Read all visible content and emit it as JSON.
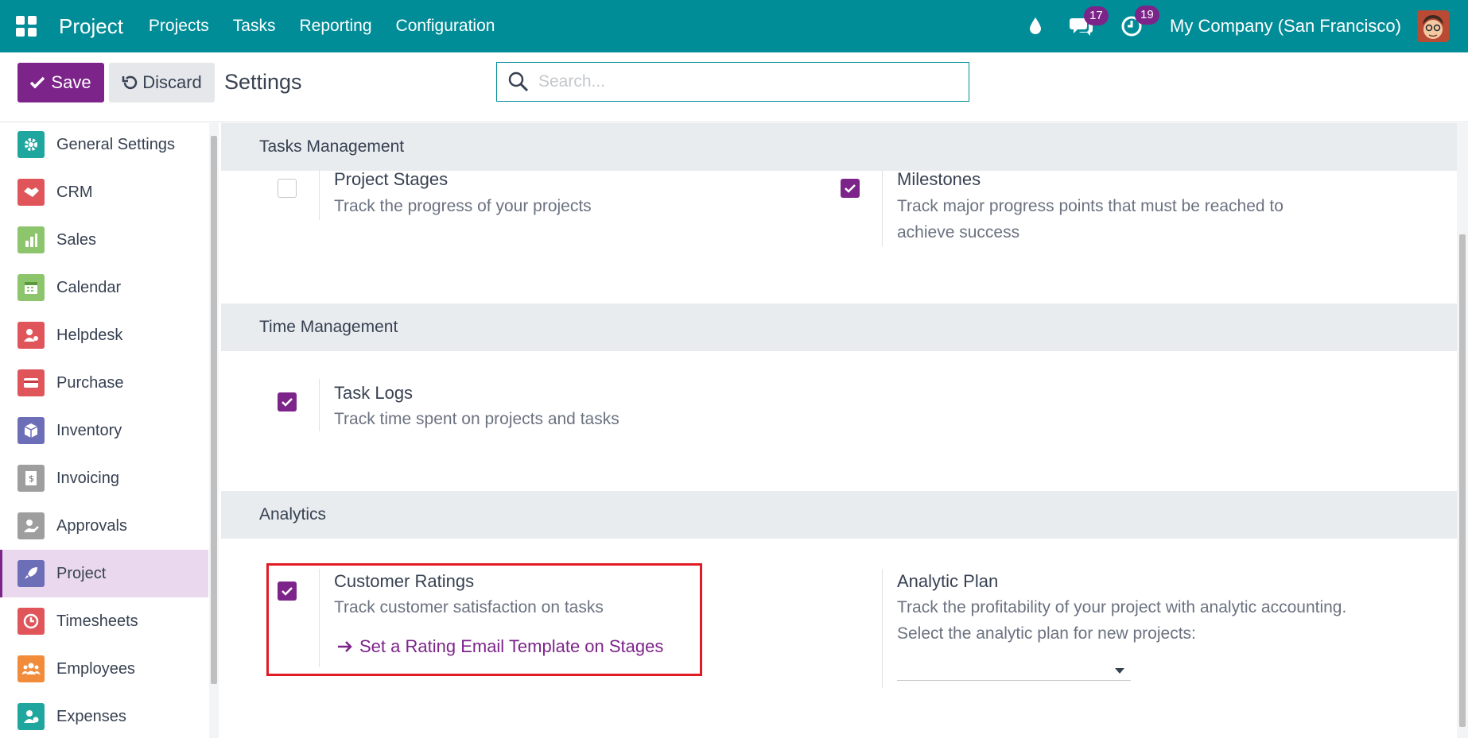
{
  "navbar": {
    "brand": "Project",
    "menu": [
      "Projects",
      "Tasks",
      "Reporting",
      "Configuration"
    ],
    "chat_badge": "17",
    "activity_badge": "19",
    "company": "My Company (San Francisco)"
  },
  "control_panel": {
    "save_label": "Save",
    "discard_label": "Discard",
    "title": "Settings",
    "search_placeholder": "Search..."
  },
  "sidebar": {
    "items": [
      {
        "label": "General Settings",
        "icon": "gear-icon",
        "color": "#1fa69e"
      },
      {
        "label": "CRM",
        "icon": "handshake-icon",
        "color": "#e0555a"
      },
      {
        "label": "Sales",
        "icon": "chart-icon",
        "color": "#8cc56b"
      },
      {
        "label": "Calendar",
        "icon": "calendar-icon",
        "color": "#8cc56b"
      },
      {
        "label": "Helpdesk",
        "icon": "helpdesk-icon",
        "color": "#e0555a"
      },
      {
        "label": "Purchase",
        "icon": "card-icon",
        "color": "#e0555a"
      },
      {
        "label": "Inventory",
        "icon": "box-icon",
        "color": "#6d6eb8"
      },
      {
        "label": "Invoicing",
        "icon": "invoice-icon",
        "color": "#9e9e9e"
      },
      {
        "label": "Approvals",
        "icon": "approval-icon",
        "color": "#9e9e9e"
      },
      {
        "label": "Project",
        "icon": "rocket-icon",
        "color": "#6d6eb8"
      },
      {
        "label": "Timesheets",
        "icon": "timesheet-icon",
        "color": "#e0555a"
      },
      {
        "label": "Employees",
        "icon": "people-icon",
        "color": "#f28b3a"
      },
      {
        "label": "Expenses",
        "icon": "expense-icon",
        "color": "#1fa69e"
      }
    ],
    "active": "Project"
  },
  "sections": {
    "tasks": {
      "heading": "Tasks Management",
      "stages_title": "Project Stages",
      "stages_desc": "Track the progress of your projects",
      "stages_checked": false,
      "milestones_title": "Milestones",
      "milestones_desc": "Track major progress points that must be reached to achieve success",
      "milestones_checked": true
    },
    "time": {
      "heading": "Time Management",
      "logs_title": "Task Logs",
      "logs_desc": "Track time spent on projects and tasks",
      "logs_checked": true
    },
    "analytics": {
      "heading": "Analytics",
      "ratings_title": "Customer Ratings",
      "ratings_desc": "Track customer satisfaction on tasks",
      "ratings_link": "Set a Rating Email Template on Stages",
      "ratings_checked": true,
      "plan_title": "Analytic Plan",
      "plan_desc": "Track the profitability of your project with analytic accounting. Select the analytic plan for new projects:"
    }
  },
  "colors": {
    "navbar": "#018d98",
    "primary": "#7c2489",
    "highlight": "#e01b24"
  }
}
